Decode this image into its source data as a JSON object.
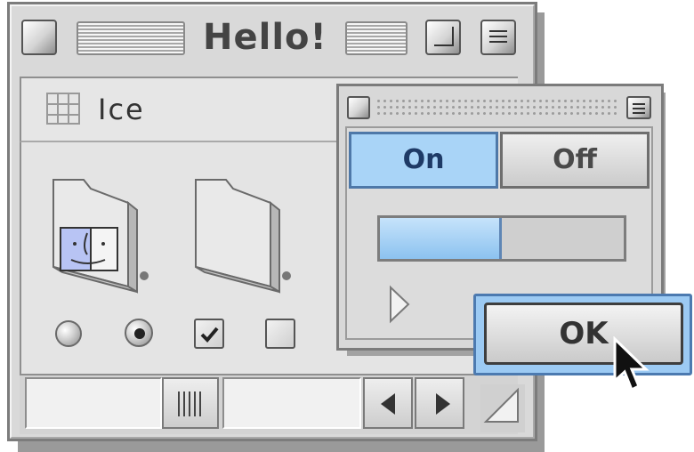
{
  "window": {
    "title": "Hello!"
  },
  "header": {
    "label": "Ice"
  },
  "palette": {
    "segmented": [
      {
        "label": "On",
        "selected": true
      },
      {
        "label": "Off",
        "selected": false
      }
    ],
    "progress": 0.5,
    "ok_label": "OK"
  },
  "controls": {
    "radio_1_selected": false,
    "radio_2_selected": true,
    "checkbox_1_checked": true,
    "checkbox_2_checked": false
  },
  "colors": {
    "accent": "#a9d4f7",
    "accent_border": "#4e78a8",
    "window_bg": "#d9d9d9"
  }
}
